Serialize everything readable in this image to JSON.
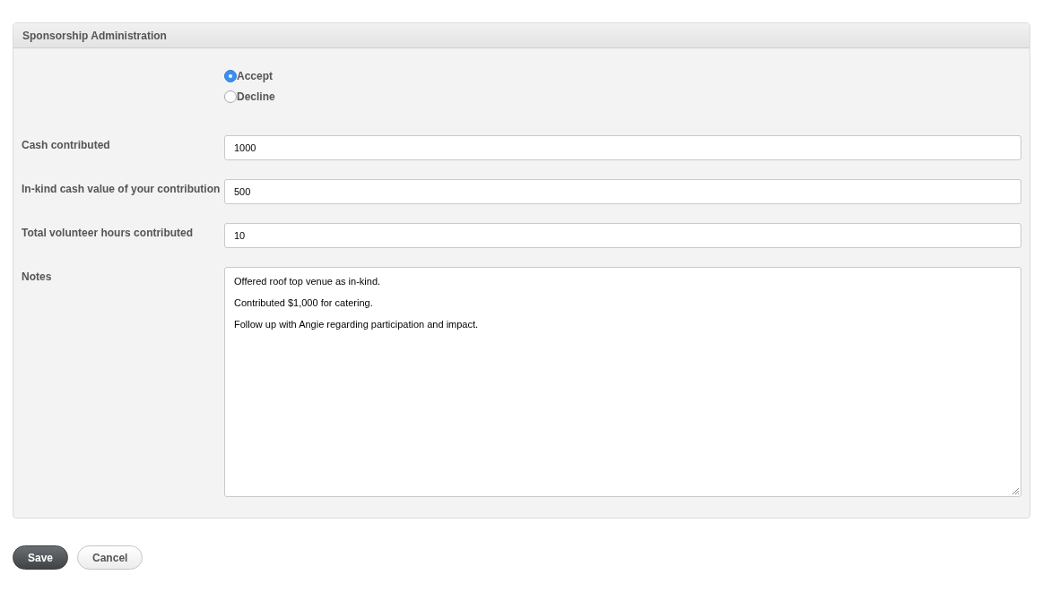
{
  "panel": {
    "title": "Sponsorship Administration"
  },
  "response_options": [
    {
      "label": "Accept",
      "selected": true
    },
    {
      "label": "Decline",
      "selected": false
    }
  ],
  "fields": [
    {
      "label": "Cash contributed",
      "value": "1000"
    },
    {
      "label": "In-kind cash value of your contribution",
      "value": "500"
    },
    {
      "label": "Total volunteer hours contributed",
      "value": "10"
    }
  ],
  "notes": {
    "label": "Notes",
    "lines": [
      "Offered roof top venue as in-kind.",
      "Contributed $1,000 for catering.",
      "Follow up with Angie regarding participation and impact."
    ]
  },
  "buttons": [
    {
      "label": "Save",
      "kind": "primary"
    },
    {
      "label": "Cancel",
      "kind": "secondary"
    }
  ]
}
